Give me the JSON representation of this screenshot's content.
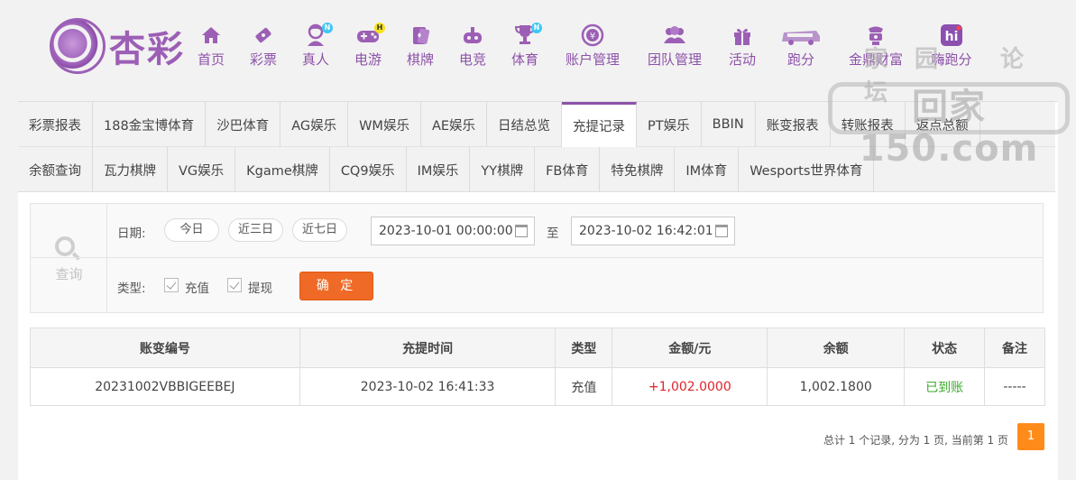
{
  "brand": {
    "name": "杏彩"
  },
  "nav": [
    {
      "label": "首页",
      "icon": "home-icon"
    },
    {
      "label": "彩票",
      "icon": "lottery-ticket-icon"
    },
    {
      "label": "真人",
      "icon": "dealer-icon",
      "badge": "N"
    },
    {
      "label": "电游",
      "icon": "gamepad-icon",
      "badge": "H"
    },
    {
      "label": "棋牌",
      "icon": "cards-icon"
    },
    {
      "label": "电竞",
      "icon": "esports-controller-icon"
    },
    {
      "label": "体育",
      "icon": "trophy-icon",
      "badge": "N"
    },
    {
      "label": "账户管理",
      "icon": "yen-coin-icon"
    },
    {
      "label": "团队管理",
      "icon": "team-icon"
    },
    {
      "label": "活动",
      "icon": "gift-icon"
    },
    {
      "label": "跑分",
      "icon": "bus-icon"
    },
    {
      "label": "金鼎财富",
      "icon": "treasure-icon"
    },
    {
      "label": "嗨跑分",
      "icon": "hi-app-icon"
    }
  ],
  "watermark": {
    "top": "家园 论坛",
    "main": "回家150.com"
  },
  "tabs_row1": [
    "彩票报表",
    "188金宝博体育",
    "沙巴体育",
    "AG娱乐",
    "WM娱乐",
    "AE娱乐",
    "日结总览",
    "充提记录",
    "PT娱乐",
    "BBIN",
    "账变报表",
    "转账报表",
    "返点总额"
  ],
  "tabs_row2": [
    "余额查询",
    "瓦力棋牌",
    "VG娱乐",
    "Kgame棋牌",
    "CQ9娱乐",
    "IM娱乐",
    "YY棋牌",
    "FB体育",
    "特免棋牌",
    "IM体育",
    "Wesports世界体育"
  ],
  "active_tab": "充提记录",
  "query": {
    "icon_label": "查询",
    "date_label": "日期:",
    "quick": [
      "今日",
      "近三日",
      "近七日"
    ],
    "start": "2023-10-01 00:00:00",
    "to": "至",
    "end": "2023-10-02 16:42:01",
    "type_label": "类型:",
    "types": [
      "充值",
      "提现"
    ],
    "confirm": "确 定"
  },
  "table": {
    "headers": [
      "账变编号",
      "充提时间",
      "类型",
      "金额/元",
      "余额",
      "状态",
      "备注"
    ],
    "rows": [
      {
        "id": "20231002VBBIGEEBEJ",
        "time": "2023-10-02 16:41:33",
        "type": "充值",
        "amount": "+1,002.0000",
        "balance": "1,002.1800",
        "status": "已到账",
        "remark": "-----"
      }
    ]
  },
  "colors": {
    "accent": "#8d52a9",
    "confirm": "#ef6a26",
    "amount": "#e0242b",
    "status_ok": "#3cab2c",
    "page_active": "#ff8c1a"
  },
  "pager": {
    "info": "总计 1 个记录, 分为 1 页, 当前第 1 页",
    "current": "1"
  }
}
